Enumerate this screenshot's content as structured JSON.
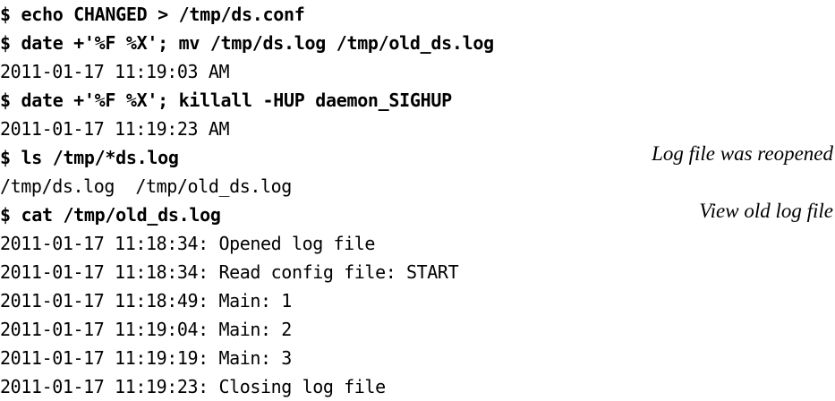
{
  "lines": [
    {
      "kind": "command",
      "text": "$ echo CHANGED > /tmp/ds.conf"
    },
    {
      "kind": "command",
      "text": "$ date +'%F %X'; mv /tmp/ds.log /tmp/old_ds.log"
    },
    {
      "kind": "output",
      "text": "2011-01-17 11:19:03 AM"
    },
    {
      "kind": "command",
      "text": "$ date +'%F %X'; killall -HUP daemon_SIGHUP"
    },
    {
      "kind": "output",
      "text": "2011-01-17 11:19:23 AM"
    },
    {
      "kind": "command",
      "text": "$ ls /tmp/*ds.log"
    },
    {
      "kind": "output",
      "text": "/tmp/ds.log  /tmp/old_ds.log"
    },
    {
      "kind": "command",
      "text": "$ cat /tmp/old_ds.log"
    },
    {
      "kind": "output",
      "text": "2011-01-17 11:18:34: Opened log file"
    },
    {
      "kind": "output",
      "text": "2011-01-17 11:18:34: Read config file: START"
    },
    {
      "kind": "output",
      "text": "2011-01-17 11:18:49: Main: 1"
    },
    {
      "kind": "output",
      "text": "2011-01-17 11:19:04: Main: 2"
    },
    {
      "kind": "output",
      "text": "2011-01-17 11:19:19: Main: 3"
    },
    {
      "kind": "output",
      "text": "2011-01-17 11:19:23: Closing log file"
    }
  ],
  "annotations": {
    "log_reopened": "Log file was reopened",
    "view_old_log": "View old log file"
  }
}
